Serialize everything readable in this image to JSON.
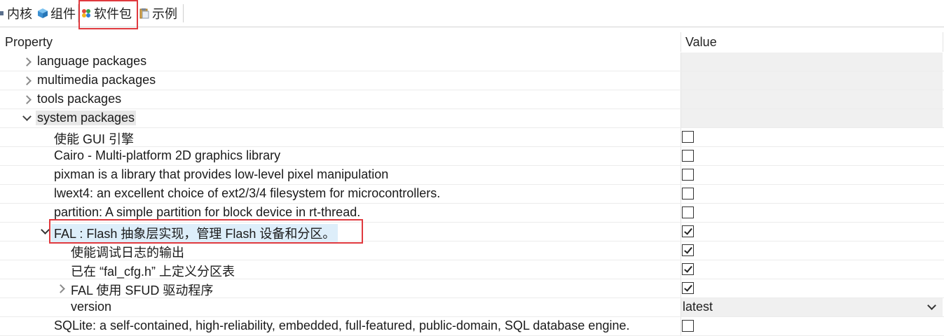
{
  "tabs": [
    {
      "label": "内核",
      "icon": "kernel-icon"
    },
    {
      "label": "组件",
      "icon": "cube-icon"
    },
    {
      "label": "软件包",
      "icon": "packages-icon",
      "active": true
    },
    {
      "label": "示例",
      "icon": "clipboard-icon"
    }
  ],
  "table": {
    "header_property": "Property",
    "header_value": "Value"
  },
  "rows": {
    "language": {
      "label": "language packages"
    },
    "multimedia": {
      "label": "multimedia packages"
    },
    "tools": {
      "label": "tools packages"
    },
    "system": {
      "label": "system packages"
    },
    "gui": {
      "label": "使能 GUI 引擎",
      "checked": false
    },
    "cairo": {
      "label": "Cairo - Multi-platform 2D graphics library",
      "checked": false
    },
    "pixman": {
      "label": "pixman is a library that provides low-level pixel manipulation",
      "checked": false
    },
    "lwext4": {
      "label": "lwext4: an excellent choice of ext2/3/4 filesystem for microcontrollers.",
      "checked": false
    },
    "partition": {
      "label": "partition: A simple partition for block device in rt-thread.",
      "checked": false
    },
    "fal": {
      "label": "FAL : Flash 抽象层实现，管理 Flash 设备和分区。",
      "checked": true
    },
    "fal_debug": {
      "label": "使能调试日志的输出",
      "checked": true
    },
    "fal_cfg": {
      "label": "已在 “fal_cfg.h” 上定义分区表",
      "checked": true
    },
    "fal_sfud": {
      "label": "FAL 使用 SFUD 驱动程序",
      "checked": true
    },
    "version": {
      "label": "version",
      "value": "latest"
    },
    "sqlite": {
      "label": "SQLite: a self-contained, high-reliability, embedded, full-featured, public-domain, SQL database engine.",
      "checked": false
    }
  },
  "colors": {
    "highlight_border": "#e0393e",
    "row_highlight": "#ddeefa"
  }
}
